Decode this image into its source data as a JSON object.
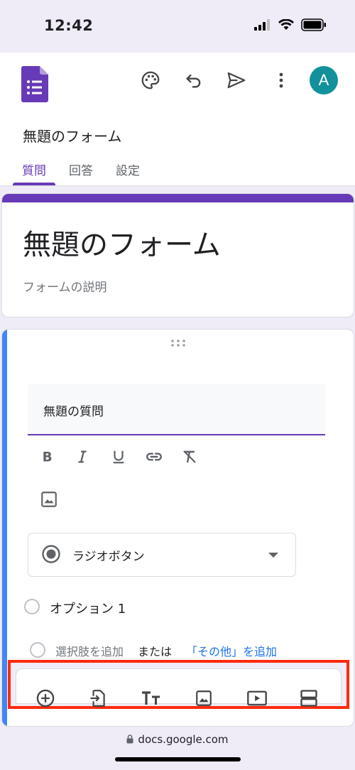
{
  "status": {
    "time": "12:42"
  },
  "header": {
    "avatar_letter": "A",
    "form_name": "無題のフォーム",
    "tabs": [
      {
        "label": "質問",
        "active": true
      },
      {
        "label": "回答",
        "active": false
      },
      {
        "label": "設定",
        "active": false
      }
    ]
  },
  "title_card": {
    "title": "無題のフォーム",
    "description_placeholder": "フォームの説明"
  },
  "question": {
    "title": "無題の質問",
    "type": "ラジオボタン",
    "options": [
      {
        "label": "オプション 1"
      }
    ],
    "add_choice": "選択肢を追加",
    "or": "または",
    "add_other": "「その他」を追加"
  },
  "browser": {
    "url": "docs.google.com"
  },
  "colors": {
    "accent": "#673ab7",
    "question_bar": "#4285f4",
    "avatar": "#12919a",
    "highlight": "#ff2a0e",
    "link": "#1a73e8"
  }
}
